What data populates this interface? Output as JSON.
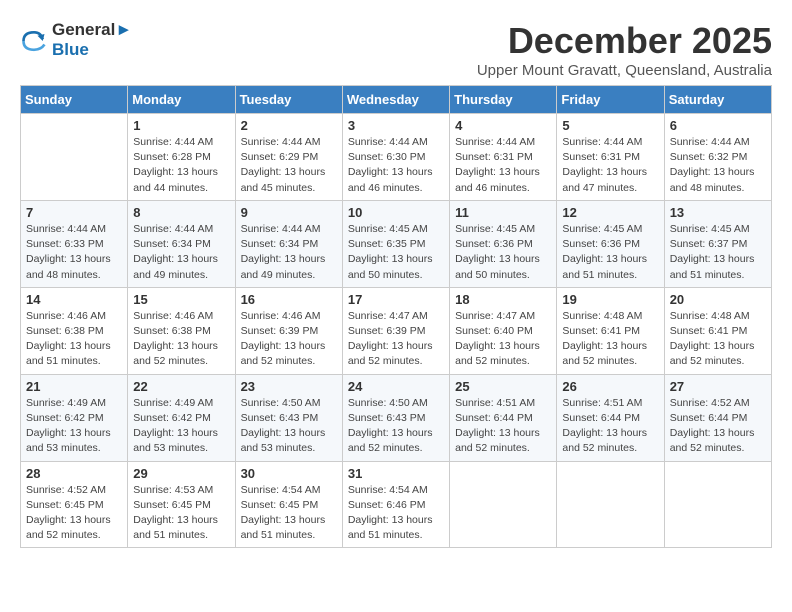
{
  "header": {
    "logo_line1": "General",
    "logo_line2": "Blue",
    "title": "December 2025",
    "subtitle": "Upper Mount Gravatt, Queensland, Australia"
  },
  "calendar": {
    "days_of_week": [
      "Sunday",
      "Monday",
      "Tuesday",
      "Wednesday",
      "Thursday",
      "Friday",
      "Saturday"
    ],
    "weeks": [
      [
        {
          "day": "",
          "info": ""
        },
        {
          "day": "1",
          "info": "Sunrise: 4:44 AM\nSunset: 6:28 PM\nDaylight: 13 hours\nand 44 minutes."
        },
        {
          "day": "2",
          "info": "Sunrise: 4:44 AM\nSunset: 6:29 PM\nDaylight: 13 hours\nand 45 minutes."
        },
        {
          "day": "3",
          "info": "Sunrise: 4:44 AM\nSunset: 6:30 PM\nDaylight: 13 hours\nand 46 minutes."
        },
        {
          "day": "4",
          "info": "Sunrise: 4:44 AM\nSunset: 6:31 PM\nDaylight: 13 hours\nand 46 minutes."
        },
        {
          "day": "5",
          "info": "Sunrise: 4:44 AM\nSunset: 6:31 PM\nDaylight: 13 hours\nand 47 minutes."
        },
        {
          "day": "6",
          "info": "Sunrise: 4:44 AM\nSunset: 6:32 PM\nDaylight: 13 hours\nand 48 minutes."
        }
      ],
      [
        {
          "day": "7",
          "info": "Sunrise: 4:44 AM\nSunset: 6:33 PM\nDaylight: 13 hours\nand 48 minutes."
        },
        {
          "day": "8",
          "info": "Sunrise: 4:44 AM\nSunset: 6:34 PM\nDaylight: 13 hours\nand 49 minutes."
        },
        {
          "day": "9",
          "info": "Sunrise: 4:44 AM\nSunset: 6:34 PM\nDaylight: 13 hours\nand 49 minutes."
        },
        {
          "day": "10",
          "info": "Sunrise: 4:45 AM\nSunset: 6:35 PM\nDaylight: 13 hours\nand 50 minutes."
        },
        {
          "day": "11",
          "info": "Sunrise: 4:45 AM\nSunset: 6:36 PM\nDaylight: 13 hours\nand 50 minutes."
        },
        {
          "day": "12",
          "info": "Sunrise: 4:45 AM\nSunset: 6:36 PM\nDaylight: 13 hours\nand 51 minutes."
        },
        {
          "day": "13",
          "info": "Sunrise: 4:45 AM\nSunset: 6:37 PM\nDaylight: 13 hours\nand 51 minutes."
        }
      ],
      [
        {
          "day": "14",
          "info": "Sunrise: 4:46 AM\nSunset: 6:38 PM\nDaylight: 13 hours\nand 51 minutes."
        },
        {
          "day": "15",
          "info": "Sunrise: 4:46 AM\nSunset: 6:38 PM\nDaylight: 13 hours\nand 52 minutes."
        },
        {
          "day": "16",
          "info": "Sunrise: 4:46 AM\nSunset: 6:39 PM\nDaylight: 13 hours\nand 52 minutes."
        },
        {
          "day": "17",
          "info": "Sunrise: 4:47 AM\nSunset: 6:39 PM\nDaylight: 13 hours\nand 52 minutes."
        },
        {
          "day": "18",
          "info": "Sunrise: 4:47 AM\nSunset: 6:40 PM\nDaylight: 13 hours\nand 52 minutes."
        },
        {
          "day": "19",
          "info": "Sunrise: 4:48 AM\nSunset: 6:41 PM\nDaylight: 13 hours\nand 52 minutes."
        },
        {
          "day": "20",
          "info": "Sunrise: 4:48 AM\nSunset: 6:41 PM\nDaylight: 13 hours\nand 52 minutes."
        }
      ],
      [
        {
          "day": "21",
          "info": "Sunrise: 4:49 AM\nSunset: 6:42 PM\nDaylight: 13 hours\nand 53 minutes."
        },
        {
          "day": "22",
          "info": "Sunrise: 4:49 AM\nSunset: 6:42 PM\nDaylight: 13 hours\nand 53 minutes."
        },
        {
          "day": "23",
          "info": "Sunrise: 4:50 AM\nSunset: 6:43 PM\nDaylight: 13 hours\nand 53 minutes."
        },
        {
          "day": "24",
          "info": "Sunrise: 4:50 AM\nSunset: 6:43 PM\nDaylight: 13 hours\nand 52 minutes."
        },
        {
          "day": "25",
          "info": "Sunrise: 4:51 AM\nSunset: 6:44 PM\nDaylight: 13 hours\nand 52 minutes."
        },
        {
          "day": "26",
          "info": "Sunrise: 4:51 AM\nSunset: 6:44 PM\nDaylight: 13 hours\nand 52 minutes."
        },
        {
          "day": "27",
          "info": "Sunrise: 4:52 AM\nSunset: 6:44 PM\nDaylight: 13 hours\nand 52 minutes."
        }
      ],
      [
        {
          "day": "28",
          "info": "Sunrise: 4:52 AM\nSunset: 6:45 PM\nDaylight: 13 hours\nand 52 minutes."
        },
        {
          "day": "29",
          "info": "Sunrise: 4:53 AM\nSunset: 6:45 PM\nDaylight: 13 hours\nand 51 minutes."
        },
        {
          "day": "30",
          "info": "Sunrise: 4:54 AM\nSunset: 6:45 PM\nDaylight: 13 hours\nand 51 minutes."
        },
        {
          "day": "31",
          "info": "Sunrise: 4:54 AM\nSunset: 6:46 PM\nDaylight: 13 hours\nand 51 minutes."
        },
        {
          "day": "",
          "info": ""
        },
        {
          "day": "",
          "info": ""
        },
        {
          "day": "",
          "info": ""
        }
      ]
    ]
  }
}
